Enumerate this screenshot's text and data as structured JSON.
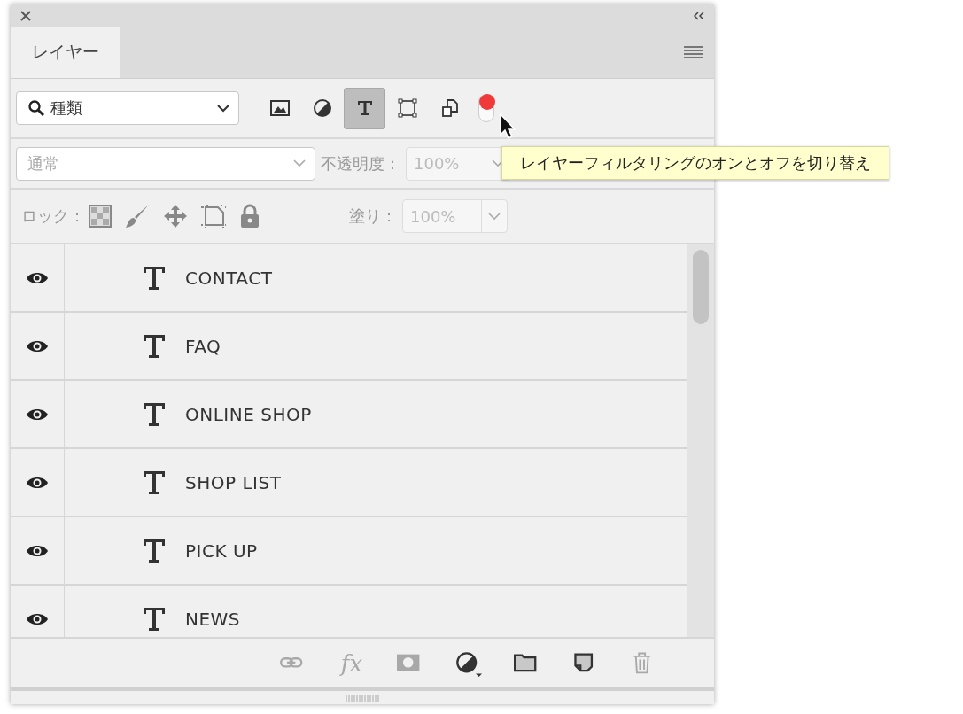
{
  "panel": {
    "tab": "レイヤー",
    "filter": {
      "value": "種類",
      "types": [
        {
          "kind": "pixel",
          "selected": false
        },
        {
          "kind": "adjustment",
          "selected": false
        },
        {
          "kind": "text",
          "selected": true
        },
        {
          "kind": "shape",
          "selected": false
        },
        {
          "kind": "smart",
          "selected": false
        }
      ],
      "filtering_on": true
    },
    "blend_mode": {
      "value": "通常",
      "disabled": true
    },
    "opacity": {
      "label": "不透明度：",
      "value": "100%",
      "disabled": true
    },
    "lock": {
      "label": "ロック："
    },
    "fill": {
      "label": "塗り：",
      "value": "100%",
      "disabled": true
    },
    "layers": [
      {
        "name": "CONTACT",
        "visible": true,
        "kind": "text"
      },
      {
        "name": "FAQ",
        "visible": true,
        "kind": "text"
      },
      {
        "name": "ONLINE SHOP",
        "visible": true,
        "kind": "text"
      },
      {
        "name": "SHOP LIST",
        "visible": true,
        "kind": "text"
      },
      {
        "name": "PICK UP",
        "visible": true,
        "kind": "text"
      },
      {
        "name": "NEWS",
        "visible": true,
        "kind": "text"
      }
    ],
    "footer": [
      {
        "kind": "link",
        "disabled": true
      },
      {
        "kind": "fx",
        "label": "fx",
        "disabled": true
      },
      {
        "kind": "mask",
        "disabled": true
      },
      {
        "kind": "adjustment",
        "disabled": false
      },
      {
        "kind": "group",
        "disabled": false
      },
      {
        "kind": "new",
        "disabled": false
      },
      {
        "kind": "trash",
        "disabled": true
      }
    ]
  },
  "tooltip": "レイヤーフィルタリングのオンとオフを切り替え"
}
